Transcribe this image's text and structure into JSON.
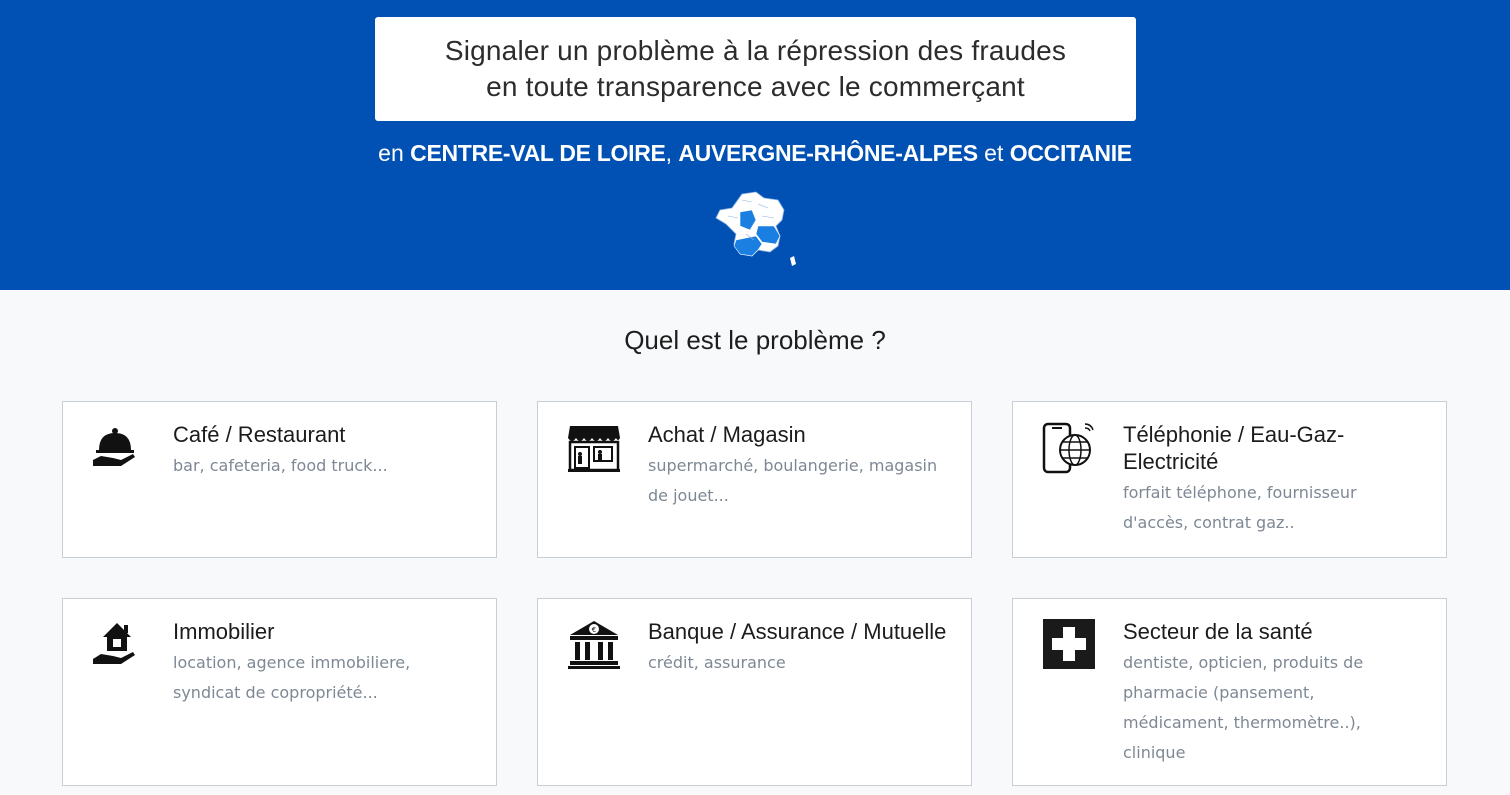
{
  "hero": {
    "line1": "Signaler un problème à la répression des fraudes",
    "line2": "en toute transparence avec le commerçant",
    "regions": {
      "prefix": "en",
      "region1": "CENTRE-VAL DE LOIRE",
      "sep1": ",",
      "region2": "AUVERGNE-RHÔNE-ALPES",
      "joiner": "et",
      "region3": "OCCITANIE"
    },
    "map_icon": "france-regions-map"
  },
  "question": "Quel est le problème ?",
  "categories": [
    {
      "title": "Café / Restaurant",
      "desc": "bar, cafeteria, food truck...",
      "icon": "cloche-icon"
    },
    {
      "title": "Achat / Magasin",
      "desc": "supermarché, boulangerie, magasin de jouet...",
      "icon": "store-icon"
    },
    {
      "title": "Téléphonie / Eau-Gaz-Electricité",
      "desc": "forfait téléphone, fournisseur d'accès, contrat gaz..",
      "icon": "phone-globe-icon"
    },
    {
      "title": "Immobilier",
      "desc": "location, agence immobiliere, syndicat de copropriété...",
      "icon": "house-hand-icon"
    },
    {
      "title": "Banque / Assurance / Mutuelle",
      "desc": "crédit, assurance",
      "icon": "bank-icon"
    },
    {
      "title": "Secteur de la santé",
      "desc": "dentiste, opticien, produits de pharmacie (pansement, médicament, thermomètre..), clinique",
      "icon": "medical-cross-icon"
    }
  ],
  "colors": {
    "primary_blue": "#0051b3",
    "card_desc": "#7e8894",
    "highlight_blue": "#1a7fe0"
  }
}
